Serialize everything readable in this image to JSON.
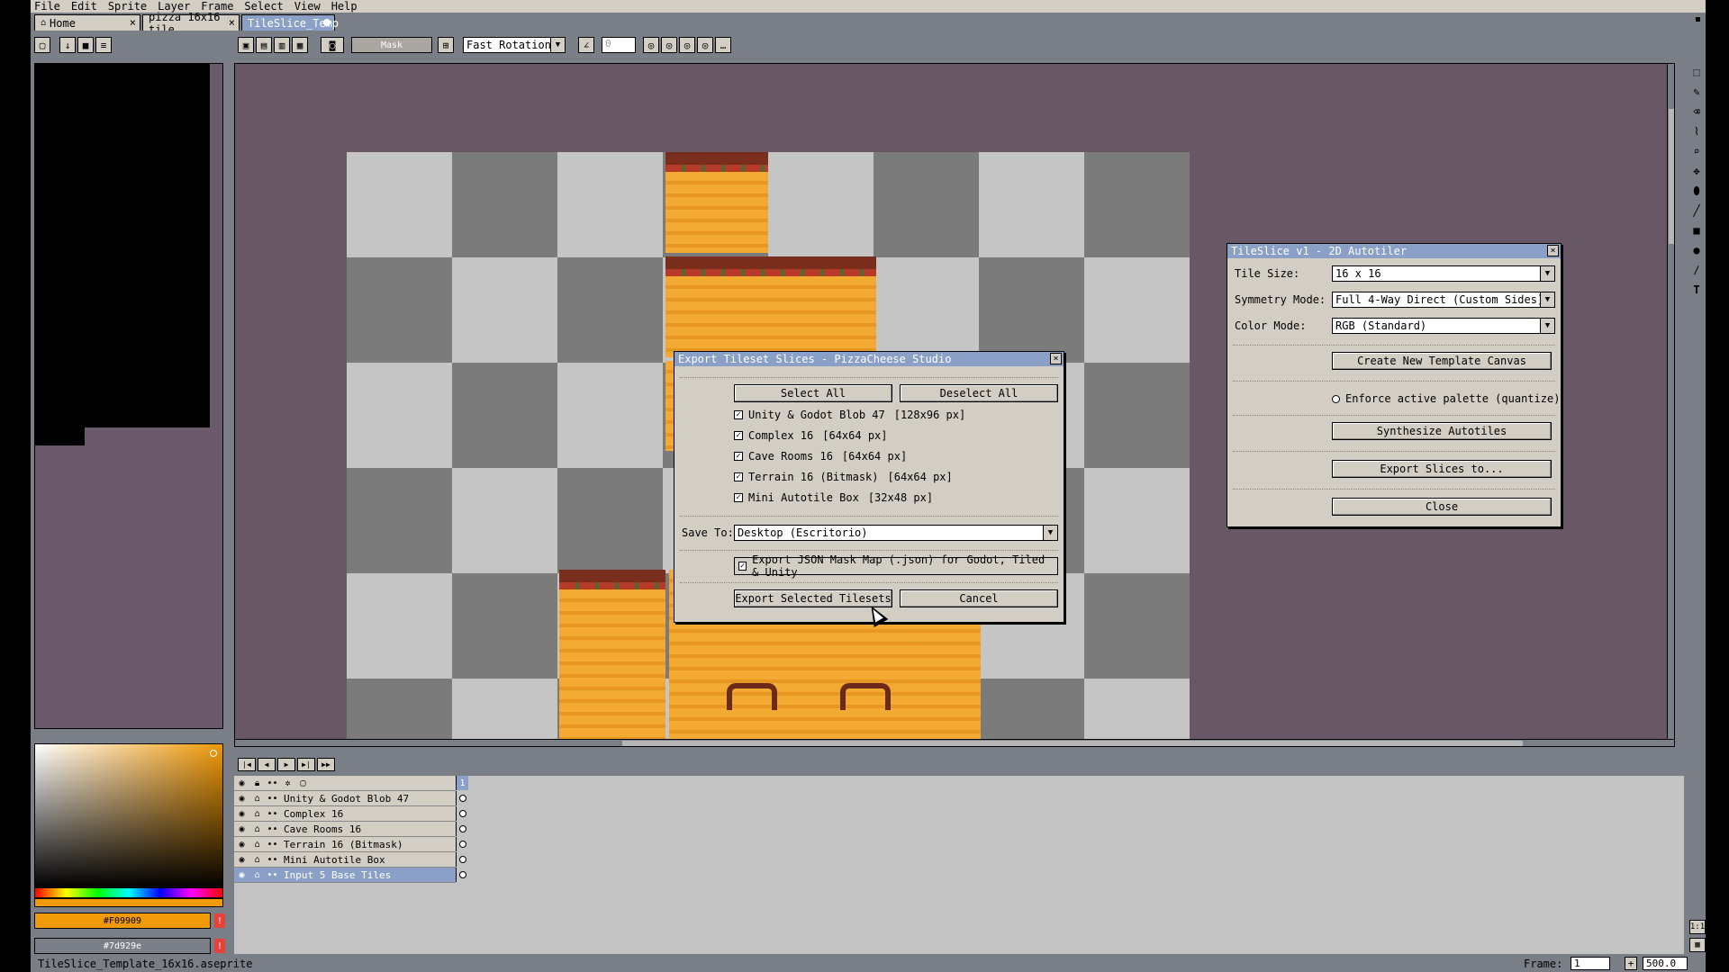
{
  "menu": [
    "File",
    "Edit",
    "Sprite",
    "Layer",
    "Frame",
    "Select",
    "View",
    "Help"
  ],
  "tabs": [
    {
      "label": "Home",
      "icon": "home-icon"
    },
    {
      "label": "pizza 16x16 tile"
    },
    {
      "label": "TileSlice_Temp"
    }
  ],
  "toolbar": {
    "mask_label": "Mask",
    "rotation_mode": "Fast Rotation",
    "angle_placeholder": "0"
  },
  "colors": {
    "foreground": "#F09909",
    "background": "#7d929e"
  },
  "layers": [
    {
      "name": "Unity & Godot Blob 47"
    },
    {
      "name": "Complex 16"
    },
    {
      "name": "Cave Rooms 16"
    },
    {
      "name": "Terrain 16 (Bitmask)"
    },
    {
      "name": "Mini Autotile Box"
    },
    {
      "name": "Input 5 Base Tiles"
    }
  ],
  "timeline": {
    "frame_number": "1"
  },
  "status": {
    "filename": "TileSlice_Template_16x16.aseprite",
    "frame_label": "Frame:",
    "frame_value": "1",
    "zoom": "500.0"
  },
  "export_dialog": {
    "title": "Export Tileset Slices - PizzaCheese Studio",
    "select_all": "Select All",
    "deselect_all": "Deselect All",
    "tilesets": [
      {
        "label": "Unity & Godot Blob 47",
        "size": "[128x96 px]",
        "checked": true
      },
      {
        "label": "Complex 16",
        "size": "[64x64 px]",
        "checked": true
      },
      {
        "label": "Cave Rooms 16",
        "size": "[64x64 px]",
        "checked": true
      },
      {
        "label": "Terrain 16 (Bitmask)",
        "size": "[64x64 px]",
        "checked": true
      },
      {
        "label": "Mini Autotile Box",
        "size": "[32x48 px]",
        "checked": true
      }
    ],
    "save_to_label": "Save To:",
    "save_to_value": "Desktop (Escritorio)",
    "json_option": "Export JSON Mask Map (.json) for Godot, Tiled & Unity",
    "export_button": "Export Selected Tilesets",
    "cancel_button": "Cancel"
  },
  "tileslice_panel": {
    "title": "TileSlice v1 - 2D Autotiler",
    "tile_size_label": "Tile Size:",
    "tile_size_value": "16 x 16",
    "symmetry_label": "Symmetry Mode:",
    "symmetry_value": "Full 4-Way Direct (Custom Sides)",
    "color_mode_label": "Color Mode:",
    "color_mode_value": "RGB (Standard)",
    "create_button": "Create New Template Canvas",
    "enforce_palette": "Enforce active palette (quantize)",
    "synthesize_button": "Synthesize Autotiles",
    "export_button": "Export Slices to...",
    "close_button": "Close"
  }
}
